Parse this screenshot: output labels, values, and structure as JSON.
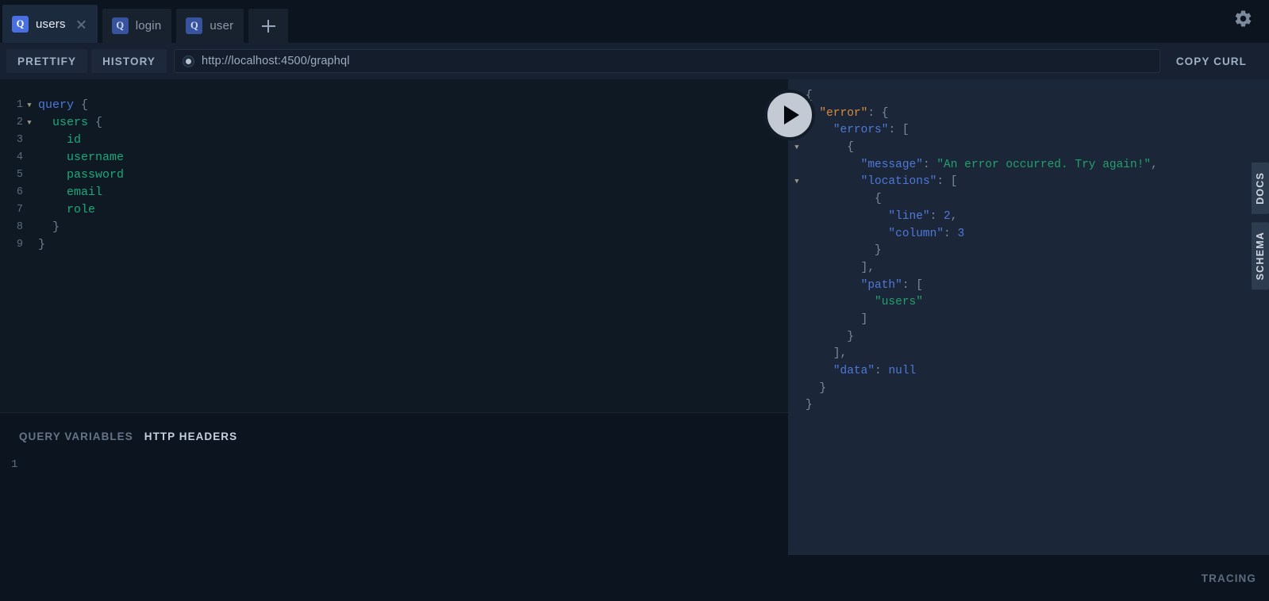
{
  "window": {
    "settings_icon": "gear-icon"
  },
  "tabs": {
    "items": [
      {
        "badge": "Q",
        "label": "users",
        "active": true,
        "closable": true
      },
      {
        "badge": "Q",
        "label": "login",
        "active": false,
        "closable": false
      },
      {
        "badge": "Q",
        "label": "user",
        "active": false,
        "closable": false
      }
    ],
    "add_label": "+"
  },
  "toolbar": {
    "prettify_label": "PRETTIFY",
    "history_label": "HISTORY",
    "endpoint_url": "http://localhost:4500/graphql",
    "copy_curl_label": "COPY CURL"
  },
  "editor": {
    "lines": [
      {
        "num": "1",
        "fold": "▼",
        "indent": 0,
        "tokens": [
          {
            "t": "query",
            "c": "kw"
          },
          {
            "t": " {",
            "c": "pnc"
          }
        ]
      },
      {
        "num": "2",
        "fold": "▼",
        "indent": 1,
        "tokens": [
          {
            "t": "users",
            "c": "fld"
          },
          {
            "t": " {",
            "c": "pnc"
          }
        ]
      },
      {
        "num": "3",
        "fold": "",
        "indent": 2,
        "tokens": [
          {
            "t": "id",
            "c": "fld"
          }
        ]
      },
      {
        "num": "4",
        "fold": "",
        "indent": 2,
        "tokens": [
          {
            "t": "username",
            "c": "fld"
          }
        ]
      },
      {
        "num": "5",
        "fold": "",
        "indent": 2,
        "tokens": [
          {
            "t": "password",
            "c": "fld"
          }
        ]
      },
      {
        "num": "6",
        "fold": "",
        "indent": 2,
        "tokens": [
          {
            "t": "email",
            "c": "fld"
          }
        ]
      },
      {
        "num": "7",
        "fold": "",
        "indent": 2,
        "tokens": [
          {
            "t": "role",
            "c": "fld"
          }
        ]
      },
      {
        "num": "8",
        "fold": "",
        "indent": 1,
        "tokens": [
          {
            "t": "}",
            "c": "pnc"
          }
        ]
      },
      {
        "num": "9",
        "fold": "",
        "indent": 0,
        "tokens": [
          {
            "t": "}",
            "c": "pnc"
          }
        ]
      }
    ]
  },
  "variables_panel": {
    "tabs": [
      {
        "label": "QUERY VARIABLES",
        "active": false
      },
      {
        "label": "HTTP HEADERS",
        "active": true
      }
    ],
    "line_number": "1",
    "content": ""
  },
  "response": {
    "lines": [
      {
        "fold": "▼",
        "indent": 0,
        "tokens": [
          {
            "t": "{",
            "c": "jpnc"
          }
        ]
      },
      {
        "fold": "▼",
        "indent": 1,
        "tokens": [
          {
            "t": "\"error\"",
            "c": "jkey-o"
          },
          {
            "t": ": {",
            "c": "jpnc"
          }
        ]
      },
      {
        "fold": "▼",
        "indent": 2,
        "tokens": [
          {
            "t": "\"errors\"",
            "c": "jkey"
          },
          {
            "t": ": [",
            "c": "jpnc"
          }
        ]
      },
      {
        "fold": "▼",
        "indent": 3,
        "tokens": [
          {
            "t": "{",
            "c": "jpnc"
          }
        ]
      },
      {
        "fold": "",
        "indent": 4,
        "tokens": [
          {
            "t": "\"message\"",
            "c": "jkey"
          },
          {
            "t": ": ",
            "c": "jpnc"
          },
          {
            "t": "\"An error occurred. Try again!\"",
            "c": "jstr"
          },
          {
            "t": ",",
            "c": "jpnc"
          }
        ]
      },
      {
        "fold": "▼",
        "indent": 4,
        "tokens": [
          {
            "t": "\"locations\"",
            "c": "jkey"
          },
          {
            "t": ": [",
            "c": "jpnc"
          }
        ]
      },
      {
        "fold": "",
        "indent": 5,
        "tokens": [
          {
            "t": "{",
            "c": "jpnc"
          }
        ]
      },
      {
        "fold": "",
        "indent": 6,
        "tokens": [
          {
            "t": "\"line\"",
            "c": "jkey"
          },
          {
            "t": ": ",
            "c": "jpnc"
          },
          {
            "t": "2",
            "c": "jnum"
          },
          {
            "t": ",",
            "c": "jpnc"
          }
        ]
      },
      {
        "fold": "",
        "indent": 6,
        "tokens": [
          {
            "t": "\"column\"",
            "c": "jkey"
          },
          {
            "t": ": ",
            "c": "jpnc"
          },
          {
            "t": "3",
            "c": "jnum"
          }
        ]
      },
      {
        "fold": "",
        "indent": 5,
        "tokens": [
          {
            "t": "}",
            "c": "jpnc"
          }
        ]
      },
      {
        "fold": "",
        "indent": 4,
        "tokens": [
          {
            "t": "],",
            "c": "jpnc"
          }
        ]
      },
      {
        "fold": "",
        "indent": 4,
        "tokens": [
          {
            "t": "\"path\"",
            "c": "jkey"
          },
          {
            "t": ": [",
            "c": "jpnc"
          }
        ]
      },
      {
        "fold": "",
        "indent": 5,
        "tokens": [
          {
            "t": "\"users\"",
            "c": "jstr"
          }
        ]
      },
      {
        "fold": "",
        "indent": 4,
        "tokens": [
          {
            "t": "]",
            "c": "jpnc"
          }
        ]
      },
      {
        "fold": "",
        "indent": 3,
        "tokens": [
          {
            "t": "}",
            "c": "jpnc"
          }
        ]
      },
      {
        "fold": "",
        "indent": 2,
        "tokens": [
          {
            "t": "],",
            "c": "jpnc"
          }
        ]
      },
      {
        "fold": "",
        "indent": 2,
        "tokens": [
          {
            "t": "\"data\"",
            "c": "jkey"
          },
          {
            "t": ": ",
            "c": "jpnc"
          },
          {
            "t": "null",
            "c": "jnull"
          }
        ]
      },
      {
        "fold": "",
        "indent": 1,
        "tokens": [
          {
            "t": "}",
            "c": "jpnc"
          }
        ]
      },
      {
        "fold": "",
        "indent": 0,
        "tokens": [
          {
            "t": "}",
            "c": "jpnc"
          }
        ]
      }
    ]
  },
  "side_tabs": [
    {
      "label": "DOCS"
    },
    {
      "label": "SCHEMA"
    }
  ],
  "footer": {
    "tracing_label": "TRACING"
  },
  "play_button": {
    "icon": "play-icon"
  },
  "colors": {
    "accent_blue": "#4a6fe0",
    "string_green": "#22a06b",
    "key_blue": "#4f78d8",
    "error_orange": "#d98c3f",
    "editor_bg": "#0f1924",
    "response_bg": "#1b2738",
    "chrome_bg": "#0c141f"
  }
}
